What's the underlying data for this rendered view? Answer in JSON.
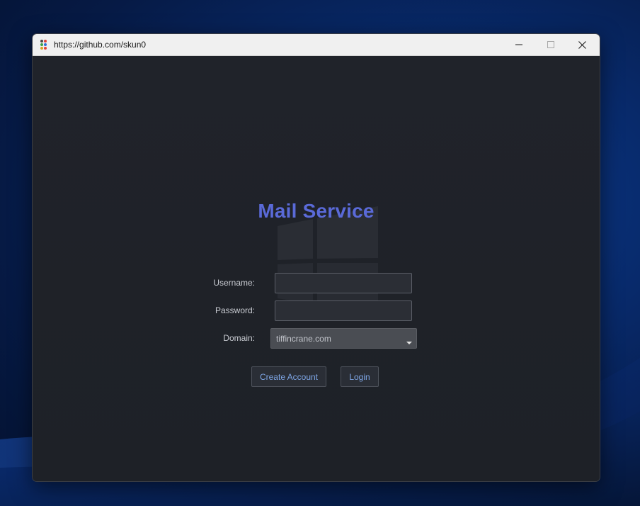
{
  "window": {
    "title": "https://github.com/skun0",
    "icon": "app-dots-icon",
    "controls": {
      "minimize_icon": "minimize-icon",
      "maximize_icon": "maximize-icon",
      "close_icon": "close-icon"
    }
  },
  "form": {
    "title": "Mail Service",
    "username_label": "Username:",
    "username_value": "",
    "password_label": "Password:",
    "password_value": "",
    "domain_label": "Domain:",
    "domain_selected": "tiffincrane.com",
    "create_account_label": "Create Account",
    "login_label": "Login"
  },
  "colors": {
    "title_accent": "#5a6ad8",
    "button_text": "#7ea6e6",
    "window_bg": "#1f2228",
    "desktop_bg": "#082a6b"
  }
}
